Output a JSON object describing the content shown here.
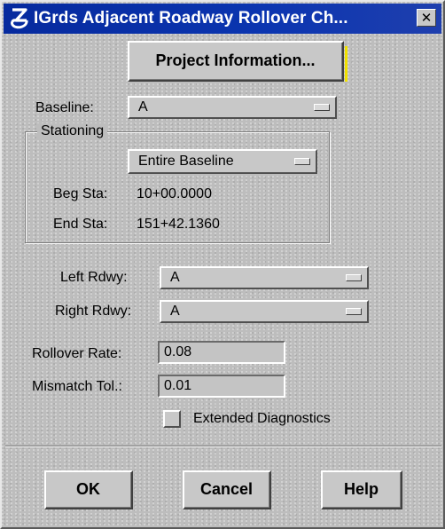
{
  "window": {
    "title": "IGrds Adjacent Roadway Rollover Ch...",
    "close_glyph": "✕"
  },
  "project_button": {
    "label": "Project Information..."
  },
  "baseline": {
    "label": "Baseline:",
    "value": "A"
  },
  "stationing": {
    "title": "Stationing",
    "range": {
      "value": "Entire Baseline"
    },
    "beg_label": "Beg Sta:",
    "beg_value": "10+00.0000",
    "end_label": "End Sta:",
    "end_value": "151+42.1360"
  },
  "left_rdwy": {
    "label": "Left Rdwy:",
    "value": "A"
  },
  "right_rdwy": {
    "label": "Right Rdwy:",
    "value": "A"
  },
  "rollover_rate": {
    "label": "Rollover Rate:",
    "value": "0.08"
  },
  "mismatch_tol": {
    "label": "Mismatch Tol.:",
    "value": "0.01"
  },
  "extended_diagnostics": {
    "label": "Extended Diagnostics",
    "checked": false
  },
  "buttons": {
    "ok": "OK",
    "cancel": "Cancel",
    "help": "Help"
  },
  "colors": {
    "titlebar": "#0b35b0",
    "dialog_bg": "#bdbdbd",
    "focus_accent": "#f0e000"
  }
}
